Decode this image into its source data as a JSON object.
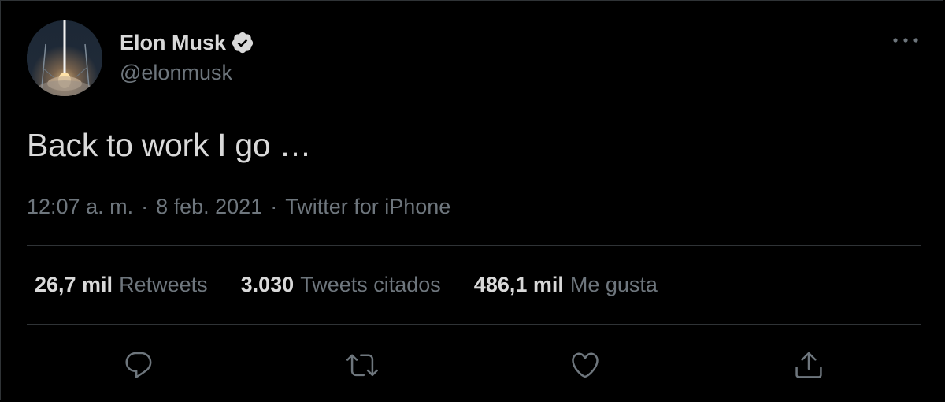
{
  "author": {
    "display_name": "Elon Musk",
    "handle": "@elonmusk",
    "verified": true,
    "avatar": "rocket-launch-avatar"
  },
  "tweet": {
    "text": "Back to work I go …",
    "time": "12:07 a. m.",
    "date": "8 feb. 2021",
    "source": "Twitter for iPhone",
    "separator": "·"
  },
  "stats": [
    {
      "value": "26,7 mil",
      "label": "Retweets"
    },
    {
      "value": "3.030",
      "label": "Tweets citados"
    },
    {
      "value": "486,1 mil",
      "label": "Me gusta"
    }
  ],
  "actions": [
    {
      "name": "reply",
      "icon": "reply-bubble-icon"
    },
    {
      "name": "retweet",
      "icon": "retweet-icon"
    },
    {
      "name": "like",
      "icon": "heart-icon"
    },
    {
      "name": "share",
      "icon": "share-icon"
    }
  ],
  "colors": {
    "background": "#000000",
    "text_primary": "#d9d9d9",
    "text_secondary": "#6e767d",
    "divider": "#2f3336"
  }
}
